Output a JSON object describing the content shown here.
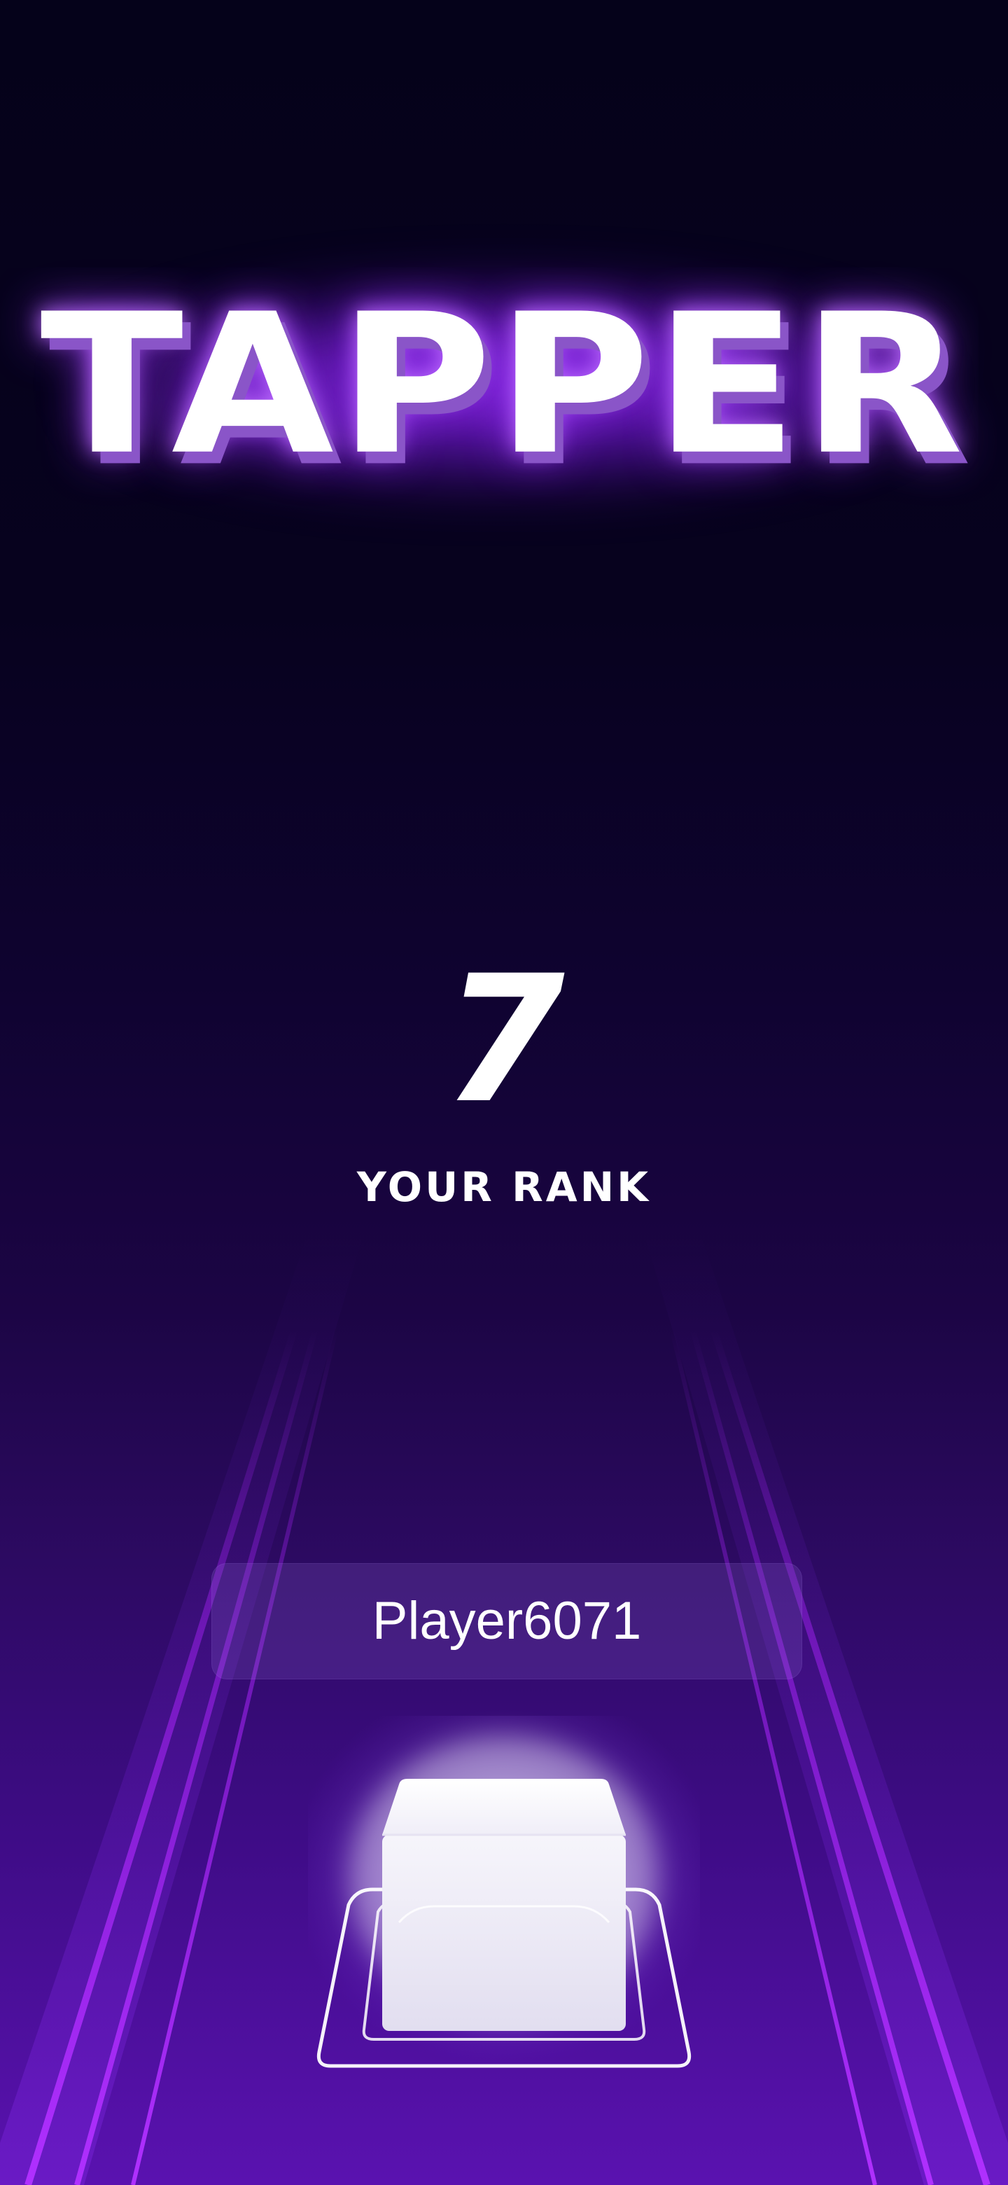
{
  "game": {
    "title": "TAPPER"
  },
  "rank": {
    "value": "7",
    "label": "YOUR RANK"
  },
  "player": {
    "name": "Player6071"
  },
  "controls": {
    "tap_button_icon": "glowing-cube-pad-icon"
  },
  "colors": {
    "background_top": "#05021a",
    "background_bottom": "#5a12b0",
    "title_glow": "#9628ff",
    "title_shadow": "#8a55c8",
    "track_line": "#a020f0",
    "text": "#ffffff"
  }
}
